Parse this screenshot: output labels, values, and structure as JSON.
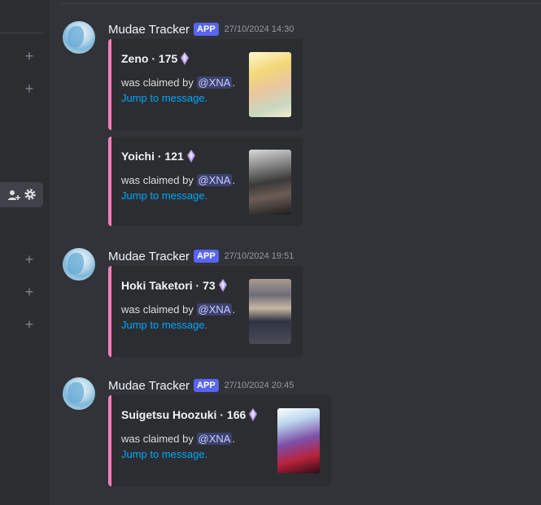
{
  "sidebar": {
    "plus_buttons": [
      "+",
      "+",
      "+",
      "+",
      "+"
    ],
    "settings_icons": [
      "add-member-icon",
      "gear-icon"
    ]
  },
  "messages": [
    {
      "author": "Mudae Tracker",
      "tag": "APP",
      "timestamp": "27/10/2024 14:30",
      "embeds": [
        {
          "character": "Zeno",
          "separator": "·",
          "value": "175",
          "claimed_text": "was claimed by",
          "mention": "@XNA",
          "period": ".",
          "jump": "Jump to message.",
          "image": "character-image-zeno"
        },
        {
          "character": "Yoichi",
          "separator": "·",
          "value": "121",
          "claimed_text": "was claimed by",
          "mention": "@XNA",
          "period": ".",
          "jump": "Jump to message.",
          "image": "character-image-yoichi"
        }
      ]
    },
    {
      "author": "Mudae Tracker",
      "tag": "APP",
      "timestamp": "27/10/2024 19:51",
      "embeds": [
        {
          "character": "Hoki Taketori",
          "separator": "·",
          "value": "73",
          "claimed_text": "was claimed by",
          "mention": "@XNA",
          "period": ".",
          "jump": "Jump to message.",
          "image": "character-image-hoki"
        }
      ]
    },
    {
      "author": "Mudae Tracker",
      "tag": "APP",
      "timestamp": "27/10/2024 20:45",
      "embeds": [
        {
          "character": "Suigetsu Hoozuki",
          "separator": "·",
          "value": "166",
          "claimed_text": "was claimed by",
          "mention": "@XNA",
          "period": ".",
          "jump": "Jump to message.",
          "image": "character-image-suigetsu"
        }
      ]
    }
  ],
  "colors": {
    "background": "#313338",
    "embed_background": "#2b2d31",
    "embed_accent": "#f47fb8",
    "app_tag": "#5865f2",
    "link": "#00a8fc",
    "mention_bg": "#3c4270"
  }
}
